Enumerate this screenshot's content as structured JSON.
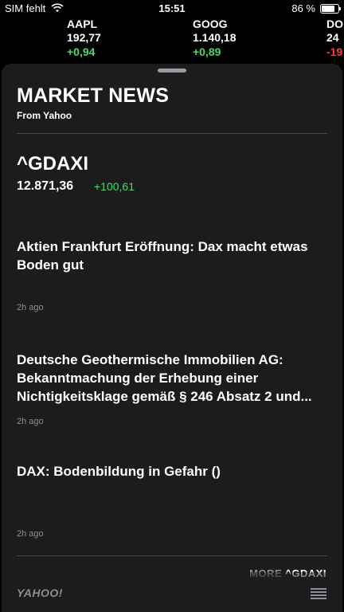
{
  "status_bar": {
    "carrier": "SIM fehlt",
    "time": "15:51",
    "battery_percent": "86 %",
    "battery_level": 0.86
  },
  "ticker": [
    {
      "symbol": "AAPL",
      "price": "192,77",
      "change": "+0,94",
      "direction": "up"
    },
    {
      "symbol": "GOOG",
      "price": "1.140,18",
      "change": "+0,89",
      "direction": "up"
    },
    {
      "symbol": "DO",
      "price": "24",
      "change": "-19",
      "direction": "down"
    }
  ],
  "panel": {
    "title": "MARKET NEWS",
    "subtitle": "From Yahoo",
    "index": {
      "symbol": "^GDAXI",
      "price": "12.871,36",
      "change": "+100,61"
    },
    "news": [
      {
        "headline": "Aktien Frankfurt Eröffnung: Dax macht etwas Boden gut",
        "age": "2h ago"
      },
      {
        "headline": "Deutsche Geothermische Immobilien AG: Bekanntmachung der Erhebung einer Nichtigkeitsklage gemäß § 246 Absatz 2 und...",
        "age": "2h ago"
      },
      {
        "headline": "DAX: Bodenbildung in Gefahr ()",
        "age": "2h ago"
      }
    ],
    "more_label": "MORE",
    "more_symbol": "^GDAXI"
  },
  "footer": {
    "logo": "YAHOO!",
    "menu_icon": "list-icon"
  },
  "colors": {
    "up": "#4cd964",
    "down": "#ff3b30",
    "panel_bg": "#1c1c1e"
  }
}
